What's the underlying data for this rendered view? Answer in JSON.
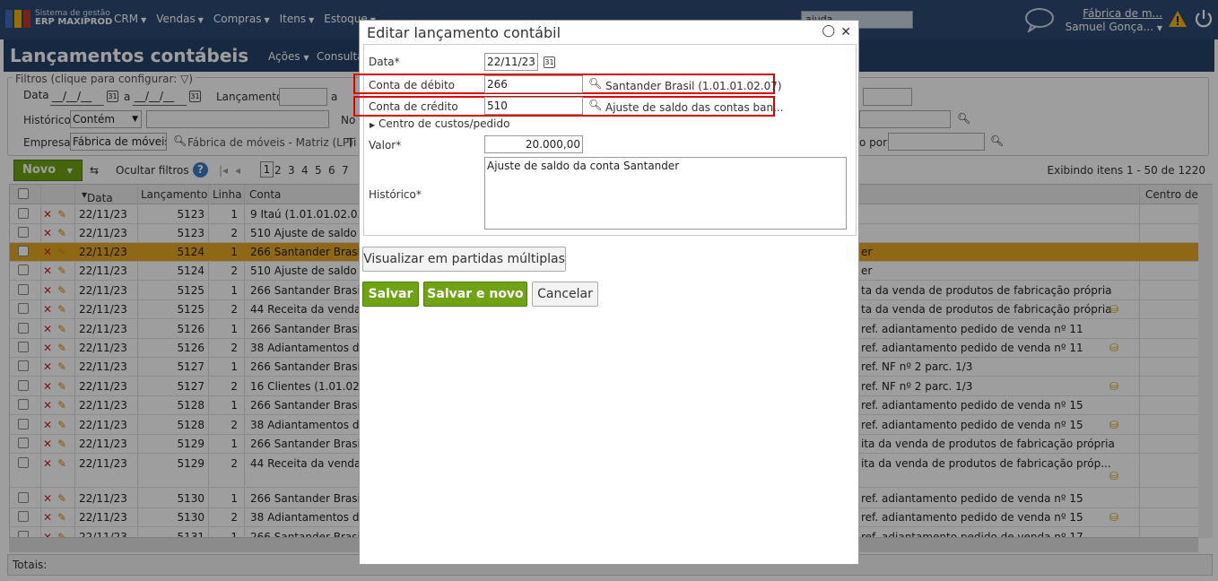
{
  "app": {
    "brand_line1": "Sistema de gestão",
    "brand_line2": "ERP MAXIPROD",
    "nav": [
      "CRM",
      "Vendas",
      "Compras",
      "Itens",
      "Estoque"
    ],
    "search_placeholder": "ajuda...",
    "company": "Fábrica de m...",
    "user": "Samuel Gonça..."
  },
  "page": {
    "title": "Lançamentos contábeis",
    "actions": "Ações",
    "consult": "Consulta"
  },
  "filters": {
    "legend": "Filtros (clique para configurar:",
    "data_label": "Data",
    "data_from": "__/__/__",
    "data_sep": "a",
    "data_to": "__/__/__",
    "lanc_label": "Lançamento",
    "lanc_sep": "a",
    "hist_label": "Histórico",
    "hist_mode": "Contém",
    "notes_label": "No",
    "empresa_label": "Empresa",
    "empresa_value": "Fábrica de móveis -",
    "empresa_name": "Fábrica de móveis - Matriz (LP)",
    "tipo_label": "Ti",
    "por_label": "o por"
  },
  "toolbar": {
    "novo": "Novo",
    "hide_filters": "Ocultar filtros",
    "current_page": "1",
    "pages": [
      "2",
      "3",
      "4",
      "5",
      "6",
      "7"
    ],
    "showing": "Exibindo itens 1 - 50 de 1220"
  },
  "grid": {
    "headers": {
      "data": "Data",
      "lanc": "Lançamento",
      "linha": "Linha",
      "conta": "Conta",
      "centro": "Centro de c"
    },
    "rows": [
      {
        "date": "22/11/23",
        "lanc": "5123",
        "line": "1",
        "conta": "9 Itaú (1.01.01.02.03)",
        "hist": ""
      },
      {
        "date": "22/11/23",
        "lanc": "5123",
        "line": "2",
        "conta": "510 Ajuste de saldo da",
        "hist": ""
      },
      {
        "date": "22/11/23",
        "lanc": "5124",
        "line": "1",
        "conta": "266 Santander Brasil (",
        "hist": "er"
      },
      {
        "date": "22/11/23",
        "lanc": "5124",
        "line": "2",
        "conta": "510 Ajuste de saldo da",
        "hist": "er"
      },
      {
        "date": "22/11/23",
        "lanc": "5125",
        "line": "1",
        "conta": "266 Santander Brasil (",
        "hist": "ta da venda de produtos de fabricação própria"
      },
      {
        "date": "22/11/23",
        "lanc": "5125",
        "line": "2",
        "conta": "44 Receita da venda de",
        "hist": "ta da venda de produtos de fabricação própria"
      },
      {
        "date": "22/11/23",
        "lanc": "5126",
        "line": "1",
        "conta": "266 Santander Brasil (",
        "hist": "ref. adiantamento pedido de venda nº 11"
      },
      {
        "date": "22/11/23",
        "lanc": "5126",
        "line": "2",
        "conta": "38 Adiantamentos de c",
        "hist": "ref. adiantamento pedido de venda nº 11"
      },
      {
        "date": "22/11/23",
        "lanc": "5127",
        "line": "1",
        "conta": "266 Santander Brasil (",
        "hist": "ref. NF nº 2 parc. 1/3"
      },
      {
        "date": "22/11/23",
        "lanc": "5127",
        "line": "2",
        "conta": "16 Clientes (1.01.02.01",
        "hist": "ref. NF nº 2 parc. 1/3"
      },
      {
        "date": "22/11/23",
        "lanc": "5128",
        "line": "1",
        "conta": "266 Santander Brasil (",
        "hist": "ref. adiantamento pedido de venda nº 15"
      },
      {
        "date": "22/11/23",
        "lanc": "5128",
        "line": "2",
        "conta": "38 Adiantamentos de c",
        "hist": "ref. adiantamento pedido de venda nº 15"
      },
      {
        "date": "22/11/23",
        "lanc": "5129",
        "line": "1",
        "conta": "266 Santander Brasil (",
        "hist": "ita da venda de produtos de fabricação própria"
      },
      {
        "date": "22/11/23",
        "lanc": "5129",
        "line": "2",
        "conta": "44 Receita da venda de",
        "hist": "ita da venda de produtos de fabricação próp..."
      },
      {
        "date": "22/11/23",
        "lanc": "5130",
        "line": "1",
        "conta": "266 Santander Brasil (",
        "hist": "ref. adiantamento pedido de venda nº 15"
      },
      {
        "date": "22/11/23",
        "lanc": "5130",
        "line": "2",
        "conta": "38 Adiantamentos de c",
        "hist": "ref. adiantamento pedido de venda nº 15"
      },
      {
        "date": "22/11/23",
        "lanc": "5131",
        "line": "1",
        "conta": "266 Santander Brasil (",
        "hist": "ref. adiantamento pedido de venda nº 17"
      }
    ],
    "totals_label": "Totais:"
  },
  "modal": {
    "title": "Editar lançamento contábil",
    "data_label": "Data*",
    "data_value": "22/11/23",
    "debit_label": "Conta de débito",
    "debit_code": "266",
    "debit_name": "Santander Brasil (1.01.01.02.07)",
    "credit_label": "Conta de crédito",
    "credit_code": "510",
    "credit_name": "Ajuste de saldo das contas ban...",
    "cost_center": "Centro de custos/pedido",
    "valor_label": "Valor*",
    "valor_value": "20.000,00",
    "hist_label": "Histórico*",
    "hist_value": "Ajuste de saldo da conta Santander",
    "multi_btn": "Visualizar em partidas múltiplas",
    "save": "Salvar",
    "save_new": "Salvar e novo",
    "cancel": "Cancelar"
  },
  "colors": {
    "topbar": "#2c4a73",
    "accent_green": "#6fa314",
    "selected_row": "#e6a823",
    "highlight": "#dd0000"
  }
}
